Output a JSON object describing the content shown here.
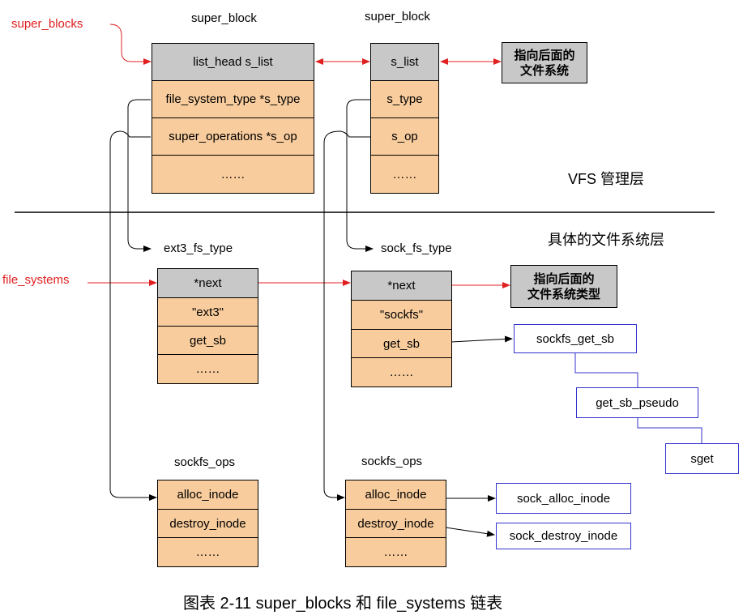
{
  "labels": {
    "super_blocks": "super_blocks",
    "super_block_1": "super_block",
    "super_block_2": "super_block",
    "vfs_layer": "VFS 管理层",
    "fs_layer": "具体的文件系统层",
    "file_systems": "file_systems",
    "ext3_fs_type": "ext3_fs_type",
    "sock_fs_type": "sock_fs_type",
    "sockfs_ops_1": "sockfs_ops",
    "sockfs_ops_2": "sockfs_ops",
    "caption": "图表 2-11 super_blocks 和 file_systems 链表"
  },
  "sb1": [
    "list_head  s_list",
    "file_system_type *s_type",
    "super_operations *s_op",
    "……"
  ],
  "sb2": [
    "s_list",
    "s_type",
    "s_op",
    "……"
  ],
  "ext3": [
    "*next",
    "\"ext3\"",
    "get_sb",
    "……"
  ],
  "sockfs": [
    "*next",
    "\"sockfs\"",
    "get_sb",
    "……"
  ],
  "ops1": [
    "alloc_inode",
    "destroy_inode",
    "……"
  ],
  "ops2": [
    "alloc_inode",
    "destroy_inode",
    "……"
  ],
  "notes": {
    "next_fs_line1": "指向后面的",
    "next_fs_line2": "文件系统",
    "next_fstype_line1": "指向后面的",
    "next_fstype_line2": "文件系统类型"
  },
  "functions": {
    "sockfs_get_sb": "sockfs_get_sb",
    "get_sb_pseudo": "get_sb_pseudo",
    "sget": "sget",
    "sock_alloc_inode": "sock_alloc_inode",
    "sock_destroy_inode": "sock_destroy_inode"
  },
  "colors": {
    "header_gray": "#c8c8c8",
    "field_peach": "#f8cc9c",
    "arrow_red": "#e02020",
    "function_border": "#3333cc"
  }
}
